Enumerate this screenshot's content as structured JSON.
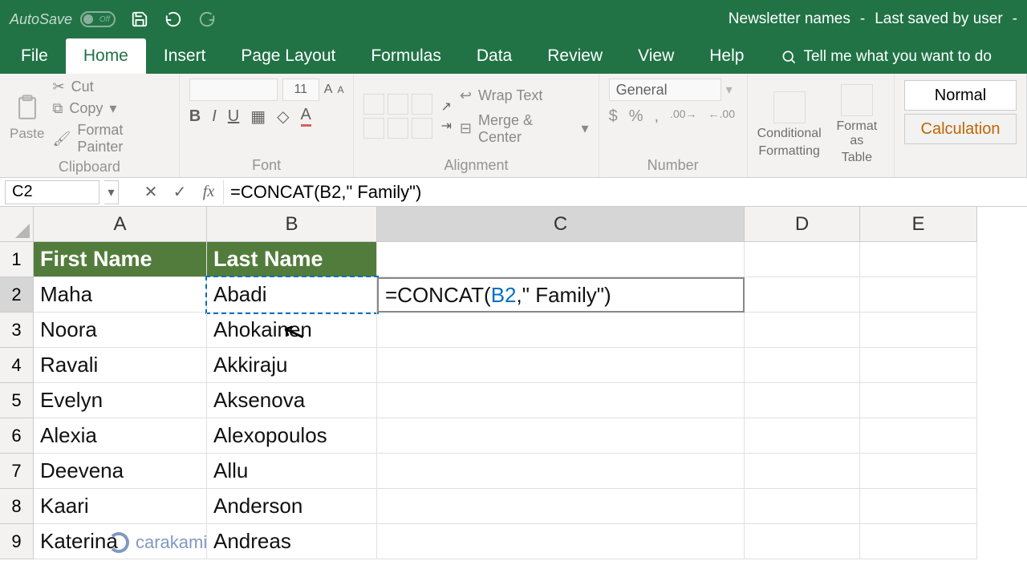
{
  "title": {
    "autosave": "AutoSave",
    "toggle": "Off",
    "doc": "Newsletter names",
    "saved": "Last saved by user"
  },
  "tabs": {
    "file": "File",
    "home": "Home",
    "insert": "Insert",
    "page_layout": "Page Layout",
    "formulas": "Formulas",
    "data": "Data",
    "review": "Review",
    "view": "View",
    "help": "Help",
    "tell_me": "Tell me what you want to do"
  },
  "ribbon": {
    "clipboard": {
      "paste": "Paste",
      "cut": "Cut",
      "copy": "Copy",
      "painter": "Format Painter",
      "label": "Clipboard"
    },
    "font": {
      "size": "11",
      "label": "Font"
    },
    "alignment": {
      "wrap": "Wrap Text",
      "merge": "Merge & Center",
      "label": "Alignment"
    },
    "number": {
      "format": "General",
      "label": "Number"
    },
    "format": {
      "cond1": "Conditional",
      "cond2": "Formatting",
      "tbl1": "Format as",
      "tbl2": "Table"
    },
    "styles": {
      "normal": "Normal",
      "calc": "Calculation"
    }
  },
  "fxbar": {
    "name": "C2",
    "formula": "=CONCAT(B2,\" Family\")"
  },
  "columns": [
    "A",
    "B",
    "C",
    "D",
    "E"
  ],
  "rowheads": [
    "1",
    "2",
    "3",
    "4",
    "5",
    "6",
    "7",
    "8",
    "9"
  ],
  "headers": {
    "a": "First Name",
    "b": "Last Name"
  },
  "rows": [
    {
      "a": "Maha",
      "b": "Abadi"
    },
    {
      "a": "Noora",
      "b": "Ahokainen"
    },
    {
      "a": "Ravali",
      "b": "Akkiraju"
    },
    {
      "a": "Evelyn",
      "b": "Aksenova"
    },
    {
      "a": "Alexia",
      "b": "Alexopoulos"
    },
    {
      "a": "Deevena",
      "b": "Allu"
    },
    {
      "a": "Kaari",
      "b": "Anderson"
    },
    {
      "a": "Katerina",
      "b": "Andreas"
    }
  ],
  "edit": {
    "prefix": "=CONCAT(",
    "ref": "B2",
    "suffix": ",\" Family\")"
  },
  "watermark": "carakami"
}
